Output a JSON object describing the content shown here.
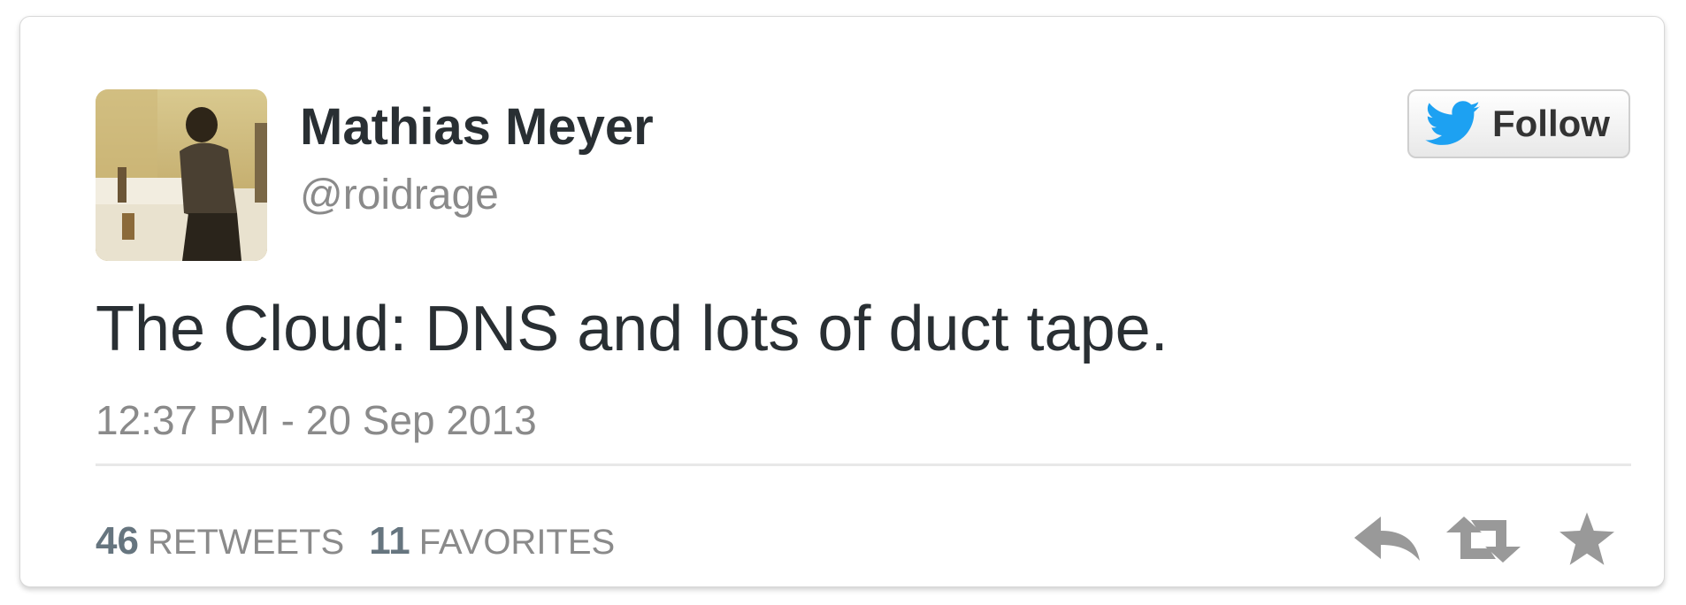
{
  "user": {
    "name": "Mathias Meyer",
    "handle": "@roidrage"
  },
  "follow_button": {
    "label": "Follow",
    "icon": "twitter-bird-icon"
  },
  "tweet": {
    "text": "The Cloud: DNS and lots of duct tape.",
    "timestamp": "12:37 PM - 20 Sep 2013"
  },
  "stats": {
    "retweets_count": "46",
    "retweets_label": "RETWEETS",
    "favorites_count": "11",
    "favorites_label": "FAVORITES"
  },
  "actions": {
    "reply_icon": "reply-icon",
    "retweet_icon": "retweet-icon",
    "favorite_icon": "star-icon"
  },
  "colors": {
    "text_primary": "#292f33",
    "text_secondary": "#8a8a8a",
    "twitter_blue": "#1da1f2",
    "icon_gray": "#999999"
  }
}
